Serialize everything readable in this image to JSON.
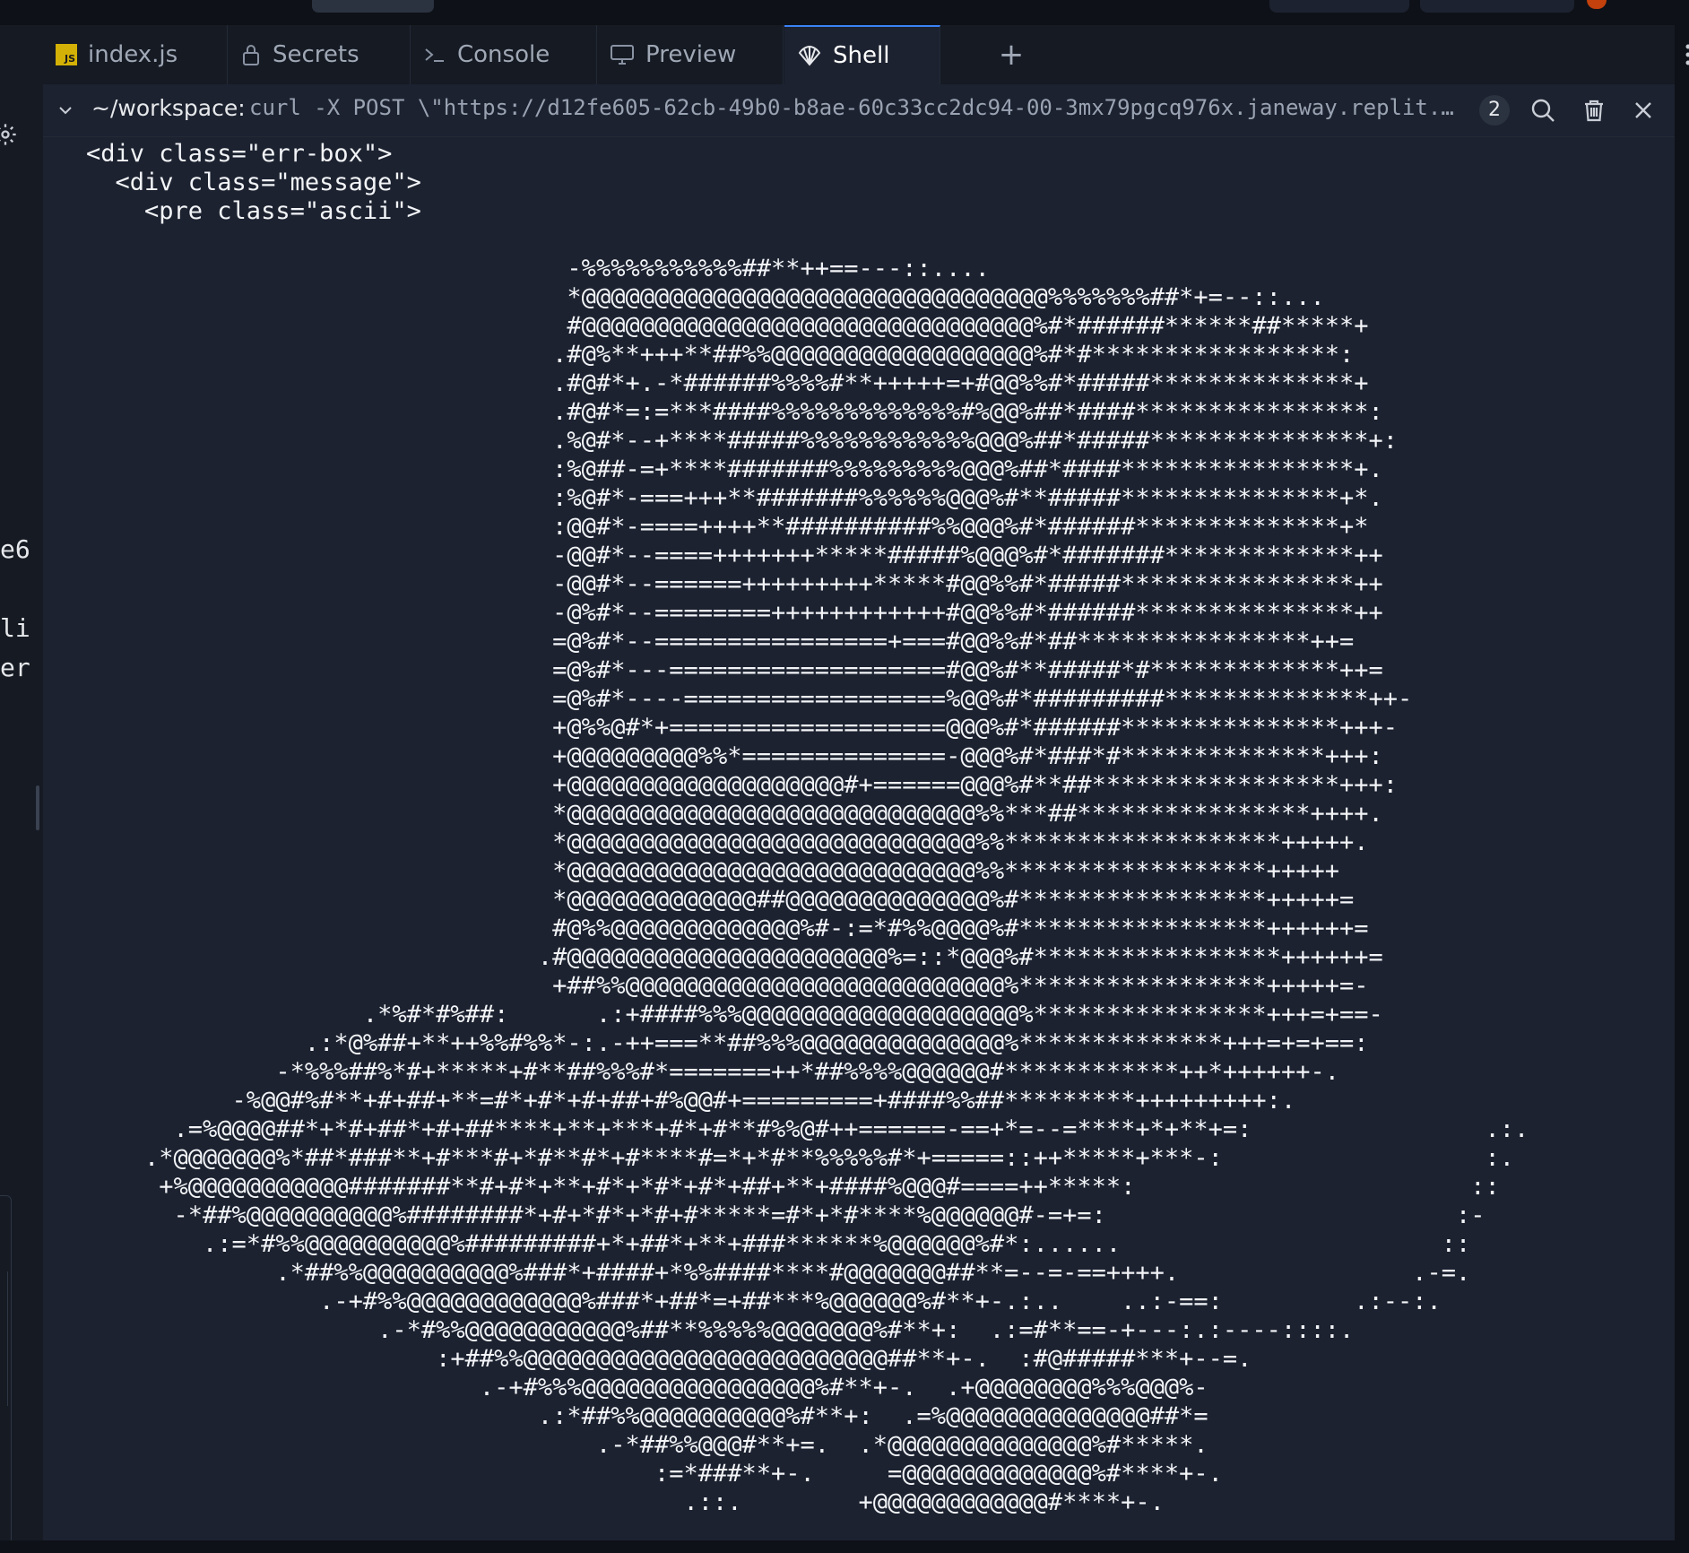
{
  "tabs": [
    {
      "label": "index.js",
      "icon": "javascript-file-icon"
    },
    {
      "label": "Secrets",
      "icon": "lock-icon"
    },
    {
      "label": "Console",
      "icon": "terminal-prompt-icon"
    },
    {
      "label": "Preview",
      "icon": "monitor-icon"
    },
    {
      "label": "Shell",
      "icon": "shell-icon",
      "active": true
    }
  ],
  "shell": {
    "prompt": "~/workspace:",
    "command": "curl -X POST \\\"https://d12fe605-62cb-49b0-b8ae-60c33cc2dc94-00-3mx79pgcq976x.janeway.replit.…",
    "badge_count": "2"
  },
  "left_pane_fragments": [
    "e6",
    "li",
    "er"
  ],
  "terminal_lines": [
    "<div class=\"err-box\">",
    "  <div class=\"message\">",
    "    <pre class=\"ascii\">",
    "",
    "                                 -%%%%%%%%%%%##**++==---::....",
    "                                 *@@@@@@@@@@@@@@@@@@@@@@@@@@@@@@@@%%%%%%%##*+=--::...",
    "                                 #@@@@@@@@@@@@@@@@@@@@@@@@@@@@@@@%#*######******##*****+",
    "                                .#@%**+++**##%%@@@@@@@@@@@@@@@@@@%#*#*****************:",
    "                                .#@#*+.-*######%%%%#**+++++=+#@@%%#*#####**************+",
    "                                .#@#*=:=***####%%%%%%%%%%%%%#%@@%##*####****************:",
    "                                .%@#*--+****#####%%%%%%%%%%%%@@@%##*#####***************+:",
    "                                :%@##-=+****#######%%%%%%%%%@@@%##*####****************+.",
    "                                :%@#*-===+++**#######%%%%%%@@@%#**#####***************+*.",
    "                                :@@#*-====++++**##########%%@@@%#*######**************+*",
    "                                -@@#*--====+++++++*****#####%@@@%#*#######*************++",
    "                                -@@#*--======+++++++++*****#@@%%#*#####****************++",
    "                                -@%#*--========++++++++++++#@@%%#*######***************++",
    "                                =@%#*--================+===#@@%%#*##****************++=",
    "                                =@%#*---===================#@@%#**#####*#*************++=",
    "                                =@%#*----==================%@@%#*#########**************++-",
    "                                +@%%@#*+===================@@@%#*######***************+++-",
    "                                +@@@@@@@@@%%*==============-@@@%#*###*#**************+++:",
    "                                +@@@@@@@@@@@@@@@@@@@#+======@@@%#**##*****************+++:",
    "                                *@@@@@@@@@@@@@@@@@@@@@@@@@@@@%%***##****************++++.",
    "                                *@@@@@@@@@@@@@@@@@@@@@@@@@@@@%%*******************+++++.",
    "                                *@@@@@@@@@@@@@@@@@@@@@@@@@@@@%%******************+++++",
    "                                *@@@@@@@@@@@@@##@@@@@@@@@@@@@@%#*****************+++++=",
    "                                #@%%@@@@@@@@@@@@@%#-:=*#%%@@@@%#*****************++++++=",
    "                               .#@@@@@@@@@@@@@@@@@@@@@@%=::*@@@%#*****************++++++=",
    "                                +##%%@@@@@@@@@@@@@@@@@@@@@@@@@@%*****************+++++=-",
    "                   .*%#*#%##:      .:+####%%%@@@@@@@@@@@@@@@@@@@%****************+++=+==-",
    "               .:*@%##+**++%%#%%*-:.-++===**##%%%@@@@@@@@@@@@@@%**************+++=+=+==:",
    "             -*%%%##%*#+*****+#**##%%%#*=======++*##%%%%@@@@@@#************++*++++++-.",
    "          -%@@#%#**+#+##+**=#*+#*+#+##+#%@@#+=========+####%%##*********+++++++++:.",
    "      .=%@@@@##*+*#+##*+#+##****+**+***+#*+#**#%%@#++======-==+*=--=****+*+**+=:                .:.",
    "    .*@@@@@@@%*##*###**+#***#+*#**#*+#****#=*+*#**%%%%%#*+=====::++*****+***-:                  :.",
    "     +%@@@@@@@@@@@#######**#+#*+**+#*+*#*+#*+##+**+####%@@@#====++*****:                       ::",
    "      -*##%@@@@@@@@@@%########*+#+*#*+*#+#*****=#*+*#****%@@@@@@#-=+=:                        :-",
    "        .:=*#%%@@@@@@@@@@%#########+*+##*+**+###******%@@@@@@%#*:......                      ::",
    "             .*##%%@@@@@@@@@@%###*+####+*%%####****#@@@@@@@##**=--=-==++++.                .-=.",
    "                .-+#%%@@@@@@@@@@@@%###*+##*=+##***%@@@@@@%#**+-.:..    ..:-==:         .:--:.",
    "                    .-*#%%@@@@@@@@@@@%##**%%%%%@@@@@@@%#**+:  .:=#**==-+---:.:----::::.",
    "                        :+##%%@@@@@@@@@@@@@@@@@@@@@@@@@##**+-.  :#@#####***+--=.",
    "                           .-+#%%%@@@@@@@@@@@@@@@@%#**+-.  .+@@@@@@@@%%%@@@%-",
    "                               .:*##%%@@@@@@@@@@%#**+:  .=%@@@@@@@@@@@@@@##*=",
    "                                   .-*##%%@@@#**+=.  .*@@@@@@@@@@@@@@%#*****.",
    "                                       :=*###**+-.     =@@@@@@@@@@@@@%#****+-.",
    "                                         .::.        +@@@@@@@@@@@@#****+-."
  ]
}
